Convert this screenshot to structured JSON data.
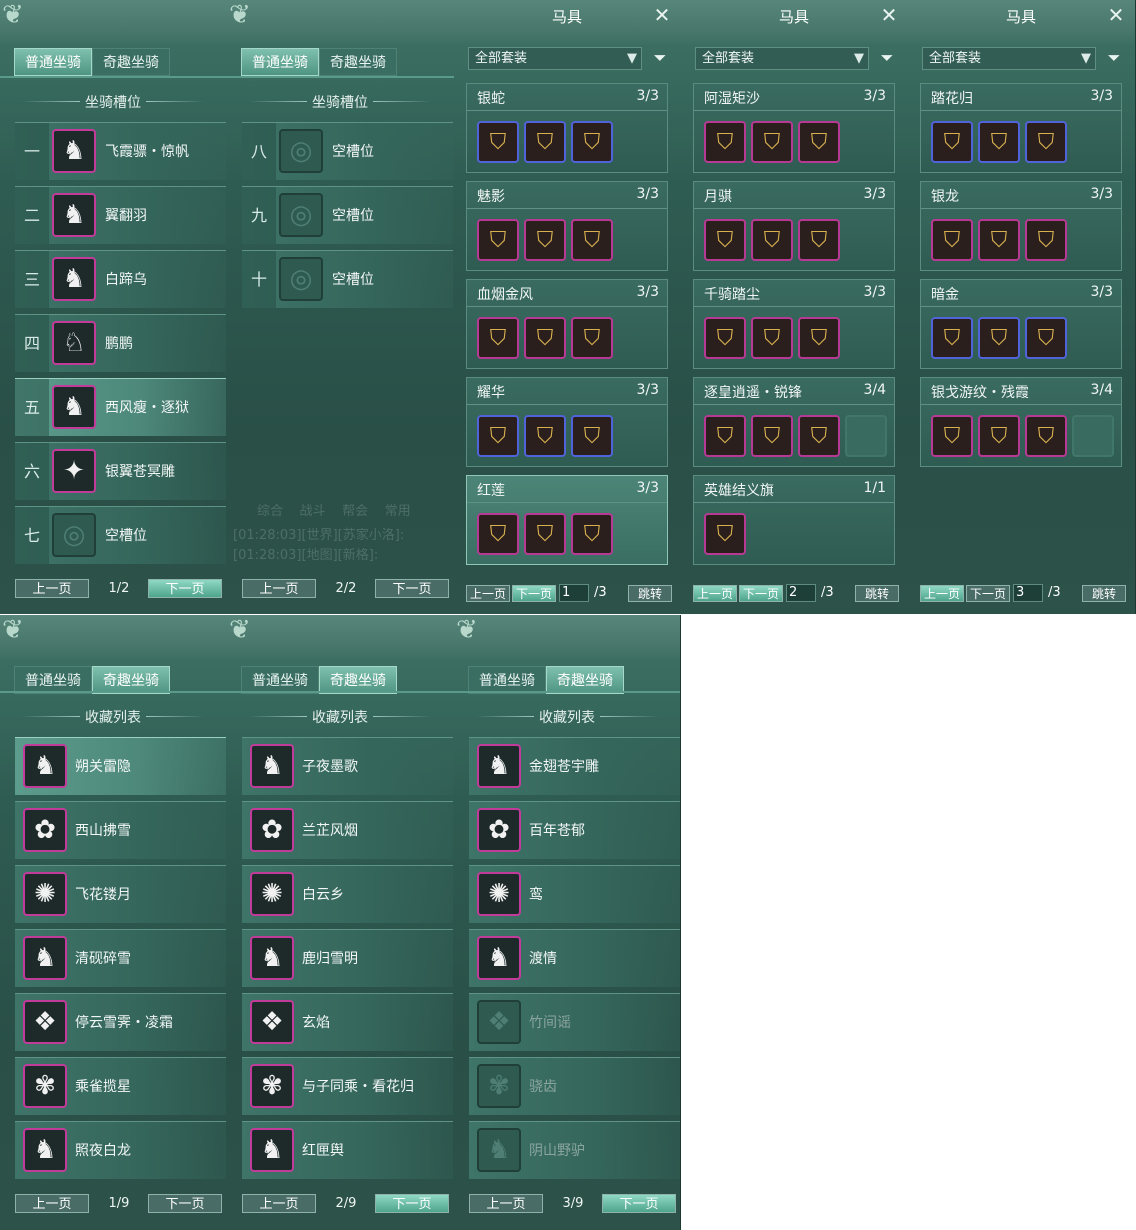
{
  "slots_page_1": {
    "tabs": [
      "普通坐骑",
      "奇趣坐骑"
    ],
    "active_tab": 0,
    "section_title": "坐骑槽位",
    "rows": [
      {
        "num": "一",
        "name": "飞霞骠・惊帆",
        "icon": "unicorn-icon"
      },
      {
        "num": "二",
        "name": "翼翻羽",
        "icon": "horse-icon"
      },
      {
        "num": "三",
        "name": "白蹄乌",
        "icon": "horse-icon"
      },
      {
        "num": "四",
        "name": "鹏鹏",
        "icon": "alpaca-icon"
      },
      {
        "num": "五",
        "name": "西风瘦・逐狱",
        "icon": "horse-icon"
      },
      {
        "num": "六",
        "name": "银翼苍冥雕",
        "icon": "eagle-icon"
      },
      {
        "num": "七",
        "name": "空槽位",
        "icon": "empty-slot-icon"
      }
    ],
    "prev": "上一页",
    "page": "1/2",
    "next": "下一页"
  },
  "slots_page_2": {
    "tabs": [
      "普通坐骑",
      "奇趣坐骑"
    ],
    "active_tab": 0,
    "section_title": "坐骑槽位",
    "rows": [
      {
        "num": "八",
        "name": "空槽位",
        "icon": "empty-slot-icon"
      },
      {
        "num": "九",
        "name": "空槽位",
        "icon": "empty-slot-icon"
      },
      {
        "num": "十",
        "name": "空槽位",
        "icon": "empty-slot-icon"
      }
    ],
    "prev": "上一页",
    "page": "2/2",
    "next": "下一页",
    "chat_ghost": {
      "tabs": [
        "综合",
        "战斗",
        "帮会",
        "常用"
      ],
      "lines": [
        "[01:28:03][世界][苏家小洛]:",
        "[01:28:03][地图][新格]:"
      ]
    }
  },
  "gear_pages": [
    {
      "title": "马具",
      "close": "✕",
      "filter": "全部套装",
      "sets": [
        {
          "name": "银蛇",
          "count": "3/3",
          "slots": [
            "blue",
            "blue",
            "blue"
          ]
        },
        {
          "name": "魅影",
          "count": "3/3",
          "slots": [
            "pink",
            "pink",
            "pink"
          ]
        },
        {
          "name": "血烟金风",
          "count": "3/3",
          "slots": [
            "pink",
            "pink",
            "pink"
          ]
        },
        {
          "name": "耀华",
          "count": "3/3",
          "slots": [
            "blue",
            "blue",
            "blue"
          ]
        },
        {
          "name": "红莲",
          "count": "3/3",
          "slots": [
            "pink",
            "pink",
            "pink"
          ]
        }
      ],
      "prev": "上一页",
      "next": "下一页",
      "page_input": "1",
      "total": "/3",
      "jump": "跳转"
    },
    {
      "title": "马具",
      "close": "✕",
      "filter": "全部套装",
      "sets": [
        {
          "name": "阿湿矩沙",
          "count": "3/3",
          "slots": [
            "pink",
            "pink",
            "pink"
          ]
        },
        {
          "name": "月骐",
          "count": "3/3",
          "slots": [
            "pink",
            "pink",
            "pink"
          ]
        },
        {
          "name": "千骑踏尘",
          "count": "3/3",
          "slots": [
            "pink",
            "pink",
            "pink"
          ]
        },
        {
          "name": "逐皇逍遥・锐锋",
          "count": "3/4",
          "slots": [
            "pink",
            "pink",
            "pink",
            "empty"
          ]
        },
        {
          "name": "英雄结义旗",
          "count": "1/1",
          "slots": [
            "pink"
          ]
        }
      ],
      "prev": "上一页",
      "next": "下一页",
      "page_input": "2",
      "total": "/3",
      "jump": "跳转"
    },
    {
      "title": "马具",
      "close": "✕",
      "filter": "全部套装",
      "sets": [
        {
          "name": "踏花归",
          "count": "3/3",
          "slots": [
            "blue",
            "blue",
            "blue"
          ]
        },
        {
          "name": "银龙",
          "count": "3/3",
          "slots": [
            "pink",
            "pink",
            "pink"
          ]
        },
        {
          "name": "暗金",
          "count": "3/3",
          "slots": [
            "blue",
            "blue",
            "blue"
          ]
        },
        {
          "name": "银戈游纹・残霞",
          "count": "3/4",
          "slots": [
            "pink",
            "pink",
            "pink",
            "empty"
          ]
        }
      ],
      "prev": "上一页",
      "next": "下一页",
      "page_input": "3",
      "total": "/3",
      "jump": "跳转"
    }
  ],
  "collection_pages": [
    {
      "tabs": [
        "普通坐骑",
        "奇趣坐骑"
      ],
      "active_tab": 1,
      "section_title": "收藏列表",
      "items": [
        "朔关雷隐",
        "西山拂雪",
        "飞花镂月",
        "清砚碎雪",
        "停云雪霁・凌霜",
        "乘雀揽星",
        "照夜白龙"
      ],
      "prev": "上一页",
      "page": "1/9",
      "next": "下一页"
    },
    {
      "tabs": [
        "普通坐骑",
        "奇趣坐骑"
      ],
      "active_tab": 1,
      "section_title": "收藏列表",
      "items": [
        "子夜墨歌",
        "兰芷风烟",
        "白云乡",
        "鹿归雪明",
        "玄焰",
        "与子同乘・看花归",
        "红匣舆"
      ],
      "prev": "上一页",
      "page": "2/9",
      "next": "下一页"
    },
    {
      "tabs": [
        "普通坐骑",
        "奇趣坐骑"
      ],
      "active_tab": 1,
      "section_title": "收藏列表",
      "items": [
        "金翅苍宇雕",
        "百年苍郁",
        "鸾",
        "渡情",
        "竹间谣",
        "骁齿",
        "阴山野驴"
      ],
      "prev": "上一页",
      "page": "3/9",
      "next": "下一页"
    }
  ],
  "colors": {
    "accent": "#7fc0ae",
    "rarity_pink": "#c03b9a",
    "rarity_blue": "#5063d8",
    "panel": "#2f5c52"
  }
}
